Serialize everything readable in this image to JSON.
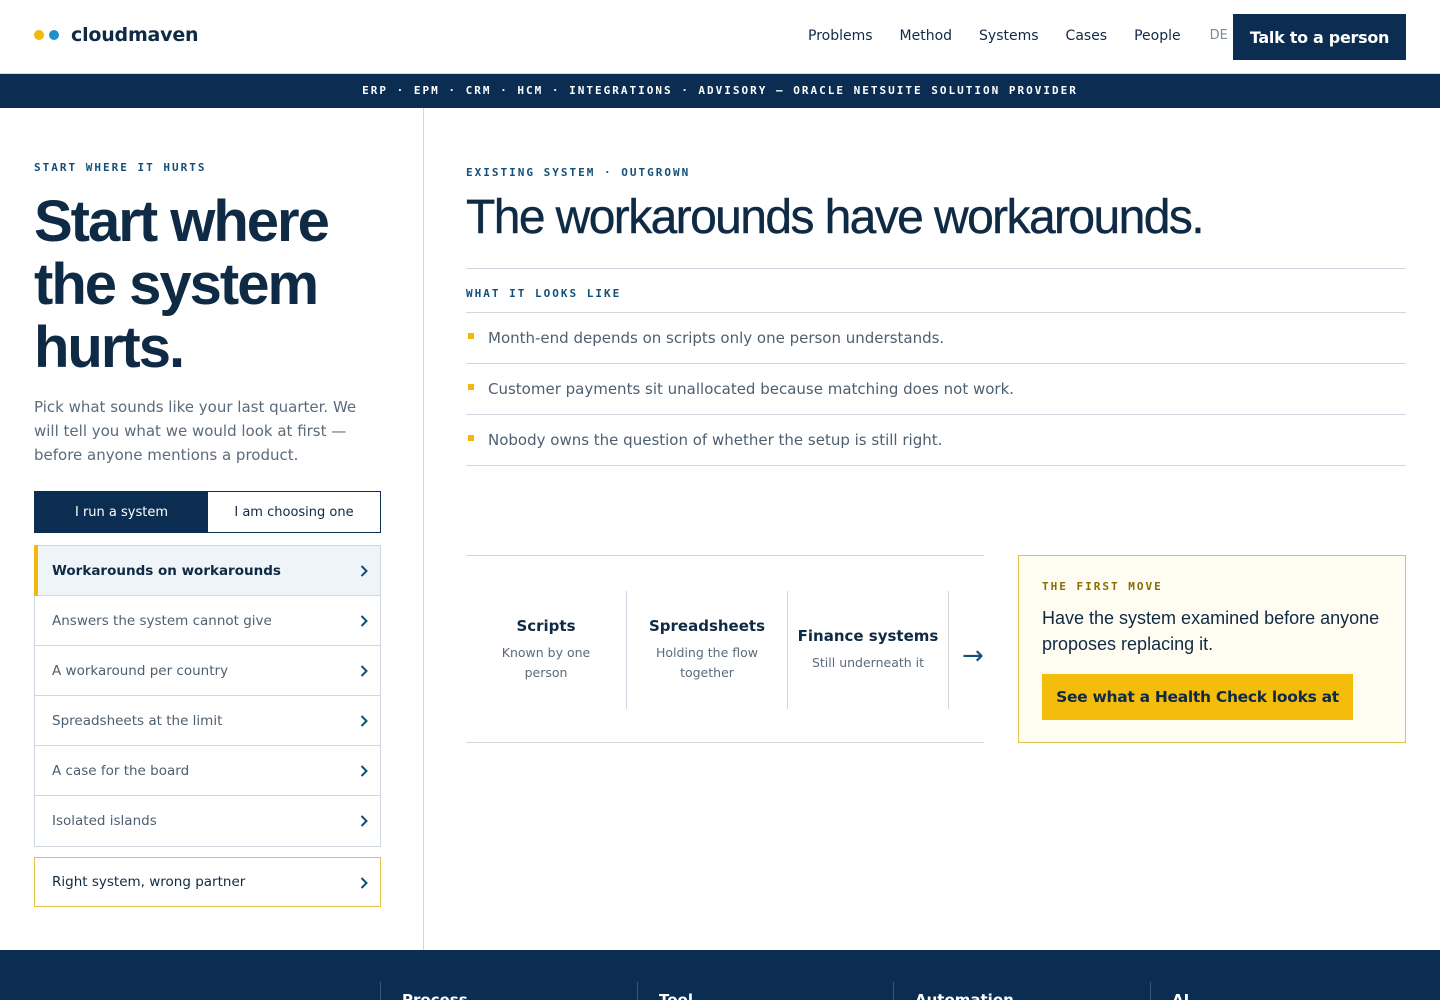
{
  "brand": {
    "name": "cloudmaven",
    "dot_colors": [
      "#f0b90b",
      "#1e8fc8"
    ]
  },
  "nav": {
    "items": [
      "Problems",
      "Method",
      "Systems",
      "Cases",
      "People"
    ],
    "language": "DE",
    "cta": "Talk to a person"
  },
  "ribbon": "ERP · EPM · CRM · HCM · INTEGRATIONS · ADVISORY — ORACLE NETSUITE SOLUTION PROVIDER",
  "left": {
    "eyebrow": "START WHERE IT HURTS",
    "title": "Start where the system hurts.",
    "intro": "Pick what sounds like your last quarter. We will tell you what we would look at first — before anyone mentions a product.",
    "toggle": {
      "selected": "I run a system",
      "other": "I am choosing one"
    },
    "problems": [
      {
        "label": "Workarounds on workarounds",
        "active": true
      },
      {
        "label": "Answers the system cannot give",
        "active": false
      },
      {
        "label": "A workaround per country",
        "active": false
      },
      {
        "label": "Spreadsheets at the limit",
        "active": false
      },
      {
        "label": "A case for the board",
        "active": false
      },
      {
        "label": "Isolated islands",
        "active": false
      }
    ],
    "partner_item": "Right system, wrong partner"
  },
  "right": {
    "eyebrow": "EXISTING SYSTEM · OUTGROWN",
    "title": "The workarounds have workarounds.",
    "symptoms_eyebrow": "WHAT IT LOOKS LIKE",
    "symptoms": [
      "Month-end depends on scripts only one person understands.",
      "Customer payments sit unallocated because matching does not work.",
      "Nobody owns the question of whether the setup is still right."
    ],
    "flow": [
      {
        "title": "Scripts",
        "sub": "Known by one person"
      },
      {
        "title": "Spreadsheets",
        "sub": "Holding the flow together"
      },
      {
        "title": "Finance systems",
        "sub": "Still underneath it"
      }
    ],
    "flow_arrow": "→",
    "first_move": {
      "eyebrow": "THE FIRST MOVE",
      "text": "Have the system examined before anyone proposes replacing it.",
      "button": "See what a Health Check looks at"
    }
  },
  "footer": {
    "columns": [
      "Process",
      "Tool",
      "Automation",
      "AI"
    ]
  },
  "colors": {
    "navy": "#0b2d52",
    "accent_yellow": "#f0b90b",
    "active_row_bg": "#eef4f8"
  }
}
